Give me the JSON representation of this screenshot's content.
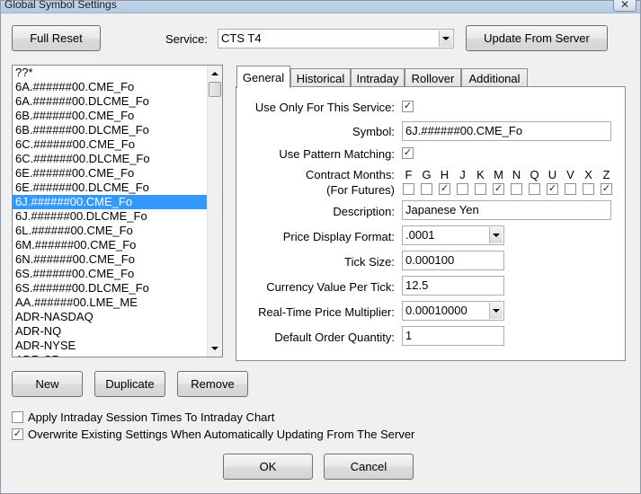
{
  "window": {
    "title": "Global Symbol Settings",
    "close_glyph": "✕"
  },
  "top": {
    "full_reset": "Full Reset",
    "service_label": "Service:",
    "service_value": "CTS T4",
    "update_button": "Update From Server"
  },
  "symbol_list": {
    "items": [
      "??*",
      "6A.######00.CME_Fo",
      "6A.######00.DLCME_Fo",
      "6B.######00.CME_Fo",
      "6B.######00.DLCME_Fo",
      "6C.######00.CME_Fo",
      "6C.######00.DLCME_Fo",
      "6E.######00.CME_Fo",
      "6E.######00.DLCME_Fo",
      "6J.######00.CME_Fo",
      "6J.######00.DLCME_Fo",
      "6L.######00.CME_Fo",
      "6M.######00.CME_Fo",
      "6N.######00.CME_Fo",
      "6S.######00.CME_Fo",
      "6S.######00.DLCME_Fo",
      "AA.######00.LME_ME",
      "ADR-NASDAQ",
      "ADR-NQ",
      "ADR-NYSE",
      "ADR-SP"
    ],
    "selected_index": 9
  },
  "tabs": [
    "General",
    "Historical",
    "Intraday",
    "Rollover",
    "Additional"
  ],
  "general": {
    "use_only_label": "Use Only For This Service:",
    "use_only_checked": true,
    "symbol_label": "Symbol:",
    "symbol_value": "6J.######00.CME_Fo",
    "pattern_label": "Use Pattern Matching:",
    "pattern_checked": true,
    "contract_months_label": "Contract Months:",
    "for_futures_label": "(For Futures)",
    "months": [
      {
        "code": "F",
        "checked": false
      },
      {
        "code": "G",
        "checked": false
      },
      {
        "code": "H",
        "checked": true
      },
      {
        "code": "J",
        "checked": false
      },
      {
        "code": "K",
        "checked": false
      },
      {
        "code": "M",
        "checked": true
      },
      {
        "code": "N",
        "checked": false
      },
      {
        "code": "Q",
        "checked": false
      },
      {
        "code": "U",
        "checked": true
      },
      {
        "code": "V",
        "checked": false
      },
      {
        "code": "X",
        "checked": false
      },
      {
        "code": "Z",
        "checked": true
      }
    ],
    "description_label": "Description:",
    "description_value": "Japanese Yen",
    "price_format_label": "Price Display Format:",
    "price_format_value": ".0001",
    "tick_size_label": "Tick Size:",
    "tick_size_value": "0.000100",
    "currency_label": "Currency Value Per Tick:",
    "currency_value": "12.5",
    "multiplier_label": "Real-Time Price Multiplier:",
    "multiplier_value": "0.00010000",
    "order_qty_label": "Default Order Quantity:",
    "order_qty_value": "1"
  },
  "list_buttons": {
    "new": "New",
    "duplicate": "Duplicate",
    "remove": "Remove"
  },
  "options": {
    "apply_intraday_label": "Apply Intraday Session Times To Intraday Chart",
    "apply_intraday_checked": false,
    "overwrite_label": "Overwrite Existing Settings When Automatically Updating From The Server",
    "overwrite_checked": true
  },
  "footer": {
    "ok": "OK",
    "cancel": "Cancel"
  },
  "check_glyph": "✓"
}
